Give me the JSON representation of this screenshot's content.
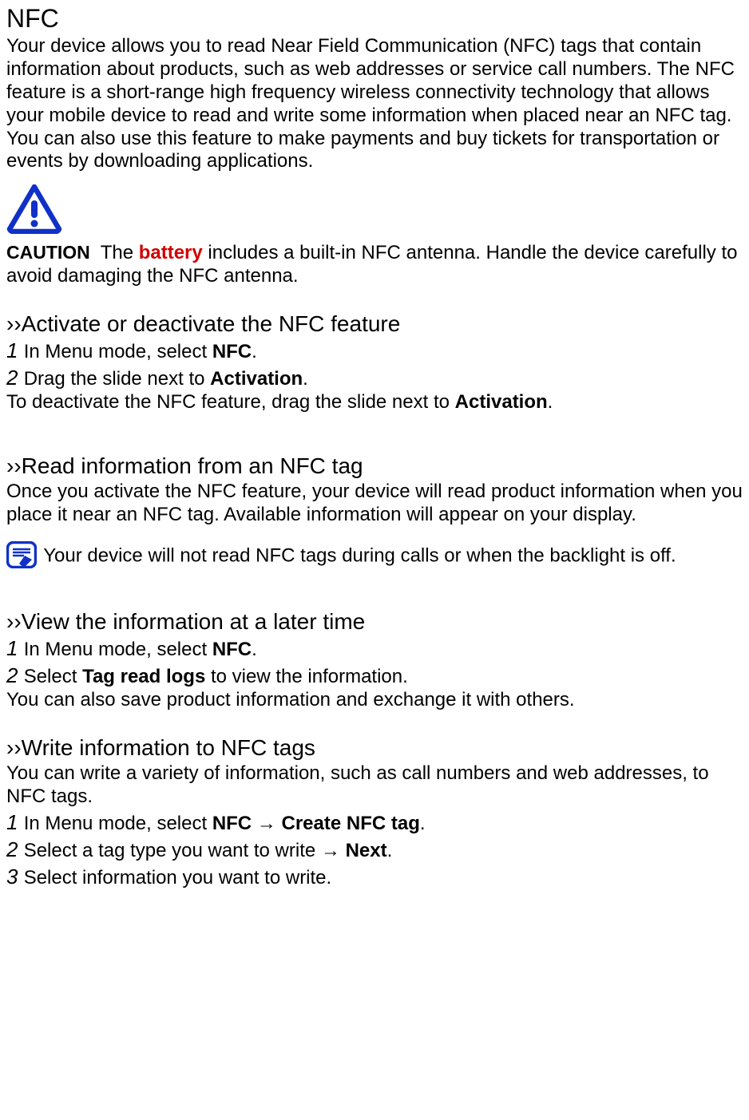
{
  "title": "NFC",
  "intro": "Your device allows you to read Near Field Communication (NFC) tags that contain information about products, such as web addresses or service call numbers. The NFC feature is a short-range high frequency wireless connectivity technology that allows your mobile device to read and write some information when placed near an NFC tag. You can also use this feature to make payments and buy tickets for transportation or events by downloading applications.",
  "caution": {
    "label": "CAUTION",
    "pre": "The ",
    "battery": "battery",
    "post": " includes a built-in NFC antenna. Handle the device carefully to avoid damaging the NFC antenna."
  },
  "sect1": {
    "heading": "››Activate or deactivate the NFC feature",
    "step1_pre": "In Menu mode, select ",
    "step1_bold": "NFC",
    "step1_post": ".",
    "step2_pre": "Drag the slide next to ",
    "step2_bold": "Activation",
    "step2_post": ".",
    "deact_pre": "To deactivate the NFC feature, drag the slide next to ",
    "deact_bold": "Activation",
    "deact_post": "."
  },
  "sect2": {
    "heading": "››Read information from an NFC tag",
    "body": "Once you activate the NFC feature, your device will read product information when you place it near an NFC tag. Available information will appear on your display.",
    "note": "Your device will not read NFC tags during calls or when the backlight is off."
  },
  "sect3": {
    "heading": "››View the information at a later time",
    "step1_pre": "In Menu mode, select ",
    "step1_bold": "NFC",
    "step1_post": ".",
    "step2_pre": "Select ",
    "step2_bold": "Tag read logs",
    "step2_post": " to view the information.",
    "extra": "You can also save product information and exchange it with others."
  },
  "sect4": {
    "heading": "››Write information to NFC tags",
    "body": "You can write a variety of information, such as call numbers and web addresses, to NFC tags.",
    "step1_pre": "In Menu mode, select ",
    "step1_bold1": "NFC",
    "step1_mid": " → ",
    "step1_bold2": "Create NFC tag",
    "step1_post": ".",
    "step2_pre": "Select a tag type you want to write → ",
    "step2_bold": "Next",
    "step2_post": ".",
    "step3": "Select information you want to write."
  },
  "nums": {
    "n1": "1 ",
    "n2": "2 ",
    "n3": "3 "
  }
}
